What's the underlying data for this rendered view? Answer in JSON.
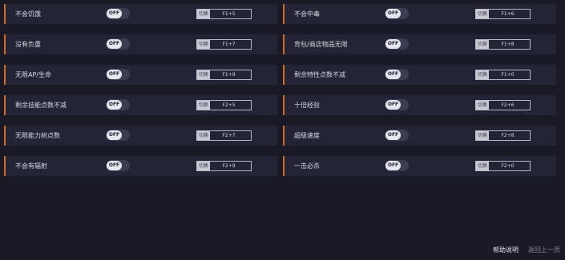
{
  "options": [
    {
      "label": "不会饥饿",
      "state": "OFF",
      "switch_label": "切换",
      "hotkey": "F1+5"
    },
    {
      "label": "不会中毒",
      "state": "OFF",
      "switch_label": "切换",
      "hotkey": "F1+6"
    },
    {
      "label": "没有负重",
      "state": "OFF",
      "switch_label": "切换",
      "hotkey": "F1+7"
    },
    {
      "label": "背包/商店物品无限",
      "state": "OFF",
      "switch_label": "切换",
      "hotkey": "F1+8"
    },
    {
      "label": "无限AP/生命",
      "state": "OFF",
      "switch_label": "切换",
      "hotkey": "F1+9"
    },
    {
      "label": "剩余特性点数不减",
      "state": "OFF",
      "switch_label": "切换",
      "hotkey": "F1+0"
    },
    {
      "label": "剩余技能点数不减",
      "state": "OFF",
      "switch_label": "切换",
      "hotkey": "F2+5"
    },
    {
      "label": "十倍经验",
      "state": "OFF",
      "switch_label": "切换",
      "hotkey": "F2+6"
    },
    {
      "label": "无限能力树点数",
      "state": "OFF",
      "switch_label": "切换",
      "hotkey": "F2+7"
    },
    {
      "label": "超级速度",
      "state": "OFF",
      "switch_label": "切换",
      "hotkey": "F2+8"
    },
    {
      "label": "不会有辐射",
      "state": "OFF",
      "switch_label": "切换",
      "hotkey": "F2+9"
    },
    {
      "label": "一击必杀",
      "state": "OFF",
      "switch_label": "切换",
      "hotkey": "F2+0"
    }
  ],
  "footer": {
    "help": "帮助说明",
    "back": "返回上一页"
  },
  "colors": {
    "background": "#1a1a27",
    "row": "#232436",
    "accent": "#d86a1c"
  }
}
